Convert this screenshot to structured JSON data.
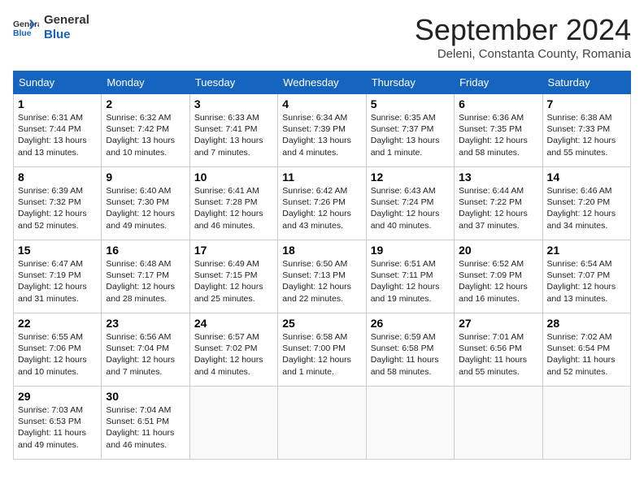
{
  "header": {
    "logo_general": "General",
    "logo_blue": "Blue",
    "month_title": "September 2024",
    "location": "Deleni, Constanta County, Romania"
  },
  "weekdays": [
    "Sunday",
    "Monday",
    "Tuesday",
    "Wednesday",
    "Thursday",
    "Friday",
    "Saturday"
  ],
  "weeks": [
    [
      {
        "day": "1",
        "sunrise": "Sunrise: 6:31 AM",
        "sunset": "Sunset: 7:44 PM",
        "daylight": "Daylight: 13 hours and 13 minutes."
      },
      {
        "day": "2",
        "sunrise": "Sunrise: 6:32 AM",
        "sunset": "Sunset: 7:42 PM",
        "daylight": "Daylight: 13 hours and 10 minutes."
      },
      {
        "day": "3",
        "sunrise": "Sunrise: 6:33 AM",
        "sunset": "Sunset: 7:41 PM",
        "daylight": "Daylight: 13 hours and 7 minutes."
      },
      {
        "day": "4",
        "sunrise": "Sunrise: 6:34 AM",
        "sunset": "Sunset: 7:39 PM",
        "daylight": "Daylight: 13 hours and 4 minutes."
      },
      {
        "day": "5",
        "sunrise": "Sunrise: 6:35 AM",
        "sunset": "Sunset: 7:37 PM",
        "daylight": "Daylight: 13 hours and 1 minute."
      },
      {
        "day": "6",
        "sunrise": "Sunrise: 6:36 AM",
        "sunset": "Sunset: 7:35 PM",
        "daylight": "Daylight: 12 hours and 58 minutes."
      },
      {
        "day": "7",
        "sunrise": "Sunrise: 6:38 AM",
        "sunset": "Sunset: 7:33 PM",
        "daylight": "Daylight: 12 hours and 55 minutes."
      }
    ],
    [
      {
        "day": "8",
        "sunrise": "Sunrise: 6:39 AM",
        "sunset": "Sunset: 7:32 PM",
        "daylight": "Daylight: 12 hours and 52 minutes."
      },
      {
        "day": "9",
        "sunrise": "Sunrise: 6:40 AM",
        "sunset": "Sunset: 7:30 PM",
        "daylight": "Daylight: 12 hours and 49 minutes."
      },
      {
        "day": "10",
        "sunrise": "Sunrise: 6:41 AM",
        "sunset": "Sunset: 7:28 PM",
        "daylight": "Daylight: 12 hours and 46 minutes."
      },
      {
        "day": "11",
        "sunrise": "Sunrise: 6:42 AM",
        "sunset": "Sunset: 7:26 PM",
        "daylight": "Daylight: 12 hours and 43 minutes."
      },
      {
        "day": "12",
        "sunrise": "Sunrise: 6:43 AM",
        "sunset": "Sunset: 7:24 PM",
        "daylight": "Daylight: 12 hours and 40 minutes."
      },
      {
        "day": "13",
        "sunrise": "Sunrise: 6:44 AM",
        "sunset": "Sunset: 7:22 PM",
        "daylight": "Daylight: 12 hours and 37 minutes."
      },
      {
        "day": "14",
        "sunrise": "Sunrise: 6:46 AM",
        "sunset": "Sunset: 7:20 PM",
        "daylight": "Daylight: 12 hours and 34 minutes."
      }
    ],
    [
      {
        "day": "15",
        "sunrise": "Sunrise: 6:47 AM",
        "sunset": "Sunset: 7:19 PM",
        "daylight": "Daylight: 12 hours and 31 minutes."
      },
      {
        "day": "16",
        "sunrise": "Sunrise: 6:48 AM",
        "sunset": "Sunset: 7:17 PM",
        "daylight": "Daylight: 12 hours and 28 minutes."
      },
      {
        "day": "17",
        "sunrise": "Sunrise: 6:49 AM",
        "sunset": "Sunset: 7:15 PM",
        "daylight": "Daylight: 12 hours and 25 minutes."
      },
      {
        "day": "18",
        "sunrise": "Sunrise: 6:50 AM",
        "sunset": "Sunset: 7:13 PM",
        "daylight": "Daylight: 12 hours and 22 minutes."
      },
      {
        "day": "19",
        "sunrise": "Sunrise: 6:51 AM",
        "sunset": "Sunset: 7:11 PM",
        "daylight": "Daylight: 12 hours and 19 minutes."
      },
      {
        "day": "20",
        "sunrise": "Sunrise: 6:52 AM",
        "sunset": "Sunset: 7:09 PM",
        "daylight": "Daylight: 12 hours and 16 minutes."
      },
      {
        "day": "21",
        "sunrise": "Sunrise: 6:54 AM",
        "sunset": "Sunset: 7:07 PM",
        "daylight": "Daylight: 12 hours and 13 minutes."
      }
    ],
    [
      {
        "day": "22",
        "sunrise": "Sunrise: 6:55 AM",
        "sunset": "Sunset: 7:06 PM",
        "daylight": "Daylight: 12 hours and 10 minutes."
      },
      {
        "day": "23",
        "sunrise": "Sunrise: 6:56 AM",
        "sunset": "Sunset: 7:04 PM",
        "daylight": "Daylight: 12 hours and 7 minutes."
      },
      {
        "day": "24",
        "sunrise": "Sunrise: 6:57 AM",
        "sunset": "Sunset: 7:02 PM",
        "daylight": "Daylight: 12 hours and 4 minutes."
      },
      {
        "day": "25",
        "sunrise": "Sunrise: 6:58 AM",
        "sunset": "Sunset: 7:00 PM",
        "daylight": "Daylight: 12 hours and 1 minute."
      },
      {
        "day": "26",
        "sunrise": "Sunrise: 6:59 AM",
        "sunset": "Sunset: 6:58 PM",
        "daylight": "Daylight: 11 hours and 58 minutes."
      },
      {
        "day": "27",
        "sunrise": "Sunrise: 7:01 AM",
        "sunset": "Sunset: 6:56 PM",
        "daylight": "Daylight: 11 hours and 55 minutes."
      },
      {
        "day": "28",
        "sunrise": "Sunrise: 7:02 AM",
        "sunset": "Sunset: 6:54 PM",
        "daylight": "Daylight: 11 hours and 52 minutes."
      }
    ],
    [
      {
        "day": "29",
        "sunrise": "Sunrise: 7:03 AM",
        "sunset": "Sunset: 6:53 PM",
        "daylight": "Daylight: 11 hours and 49 minutes."
      },
      {
        "day": "30",
        "sunrise": "Sunrise: 7:04 AM",
        "sunset": "Sunset: 6:51 PM",
        "daylight": "Daylight: 11 hours and 46 minutes."
      },
      {
        "day": "",
        "sunrise": "",
        "sunset": "",
        "daylight": ""
      },
      {
        "day": "",
        "sunrise": "",
        "sunset": "",
        "daylight": ""
      },
      {
        "day": "",
        "sunrise": "",
        "sunset": "",
        "daylight": ""
      },
      {
        "day": "",
        "sunrise": "",
        "sunset": "",
        "daylight": ""
      },
      {
        "day": "",
        "sunrise": "",
        "sunset": "",
        "daylight": ""
      }
    ]
  ]
}
